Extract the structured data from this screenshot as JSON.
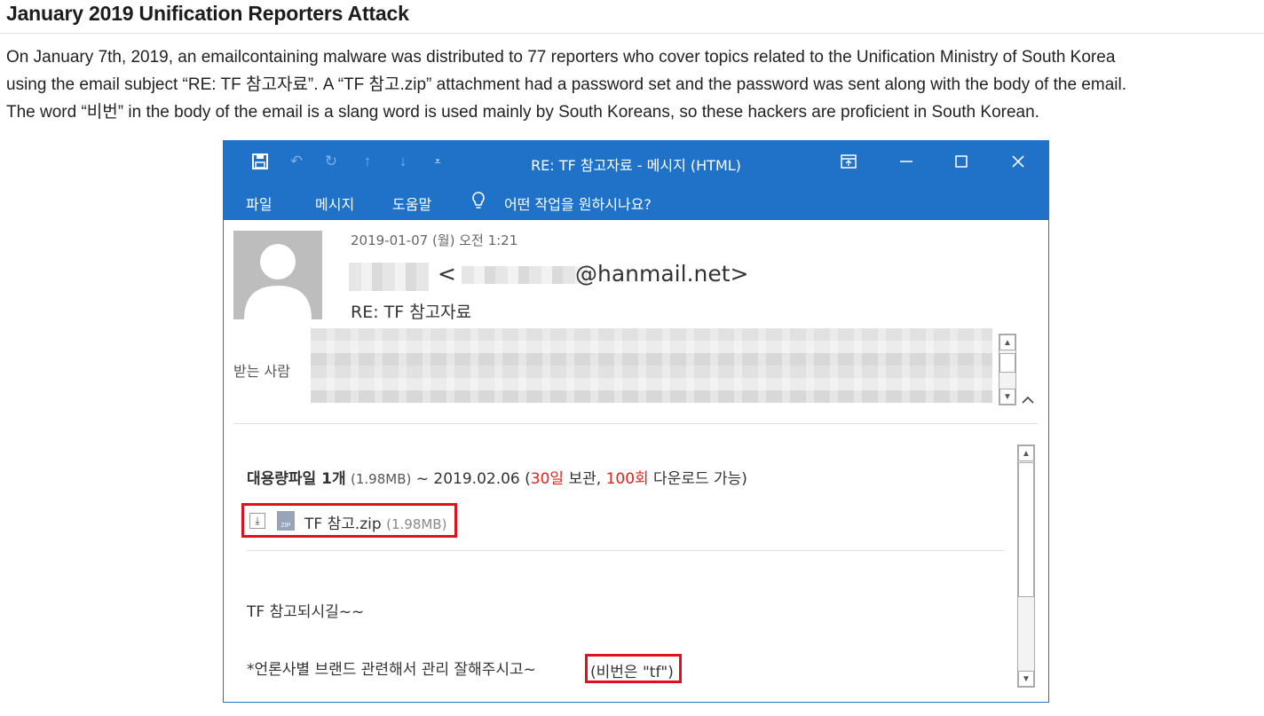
{
  "article": {
    "heading": "January 2019 Unification Reporters Attack",
    "paragraph_lines": [
      "On January 7th, 2019, an emailcontaining malware was distributed to 77 reporters who cover topics related to the Unification Ministry of South Korea",
      "using the email subject “RE: TF 참고자료”. A “TF 참고.zip” attachment had a password set and the password was sent along with the body of the email.",
      "The word “비번” in the body of the email is a slang word is used mainly by South Koreans, so these hackers are proficient in South Korean."
    ]
  },
  "window": {
    "title": "RE: TF 참고자료  -  메시지 (HTML)",
    "accent_color": "#1f72c7",
    "toolbar_icons": [
      "save-icon",
      "undo-icon",
      "redo-icon",
      "up-arrow-icon",
      "down-arrow-icon",
      "customize-dropdown-icon"
    ],
    "controls": [
      "ribbon-display-icon",
      "minimize-icon",
      "maximize-icon",
      "close-icon"
    ]
  },
  "ribbon": {
    "tabs": [
      "파일",
      "메시지",
      "도움말"
    ],
    "tell_me": "어떤 작업을 원하시나요?"
  },
  "email": {
    "date": "2019-01-07 (월) 오전 1:21",
    "from_open": "<",
    "from_domain": "@hanmail.net>",
    "subject": "RE: TF 참고자료",
    "to_label": "받는 사람",
    "bigfile_label": "대용량파일 1개",
    "bigfile_size": "(1.98MB)",
    "bigfile_expiry": "~ 2019.02.06 (",
    "bigfile_days": "30일",
    "bigfile_keep": " 보관, ",
    "bigfile_count": "100회",
    "bigfile_download": " 다운로드 가능)",
    "attachment_name": "TF 참고.zip",
    "attachment_size": "(1.98MB)",
    "zip_label": "ZIP",
    "body_line1": "TF 참고되시길~~",
    "body_line2": "*언론사별 브랜드 관련해서 관리 잘해주시고~",
    "body_password": "(비번은 \"tf\")",
    "highlight_color": "#e0101c"
  }
}
